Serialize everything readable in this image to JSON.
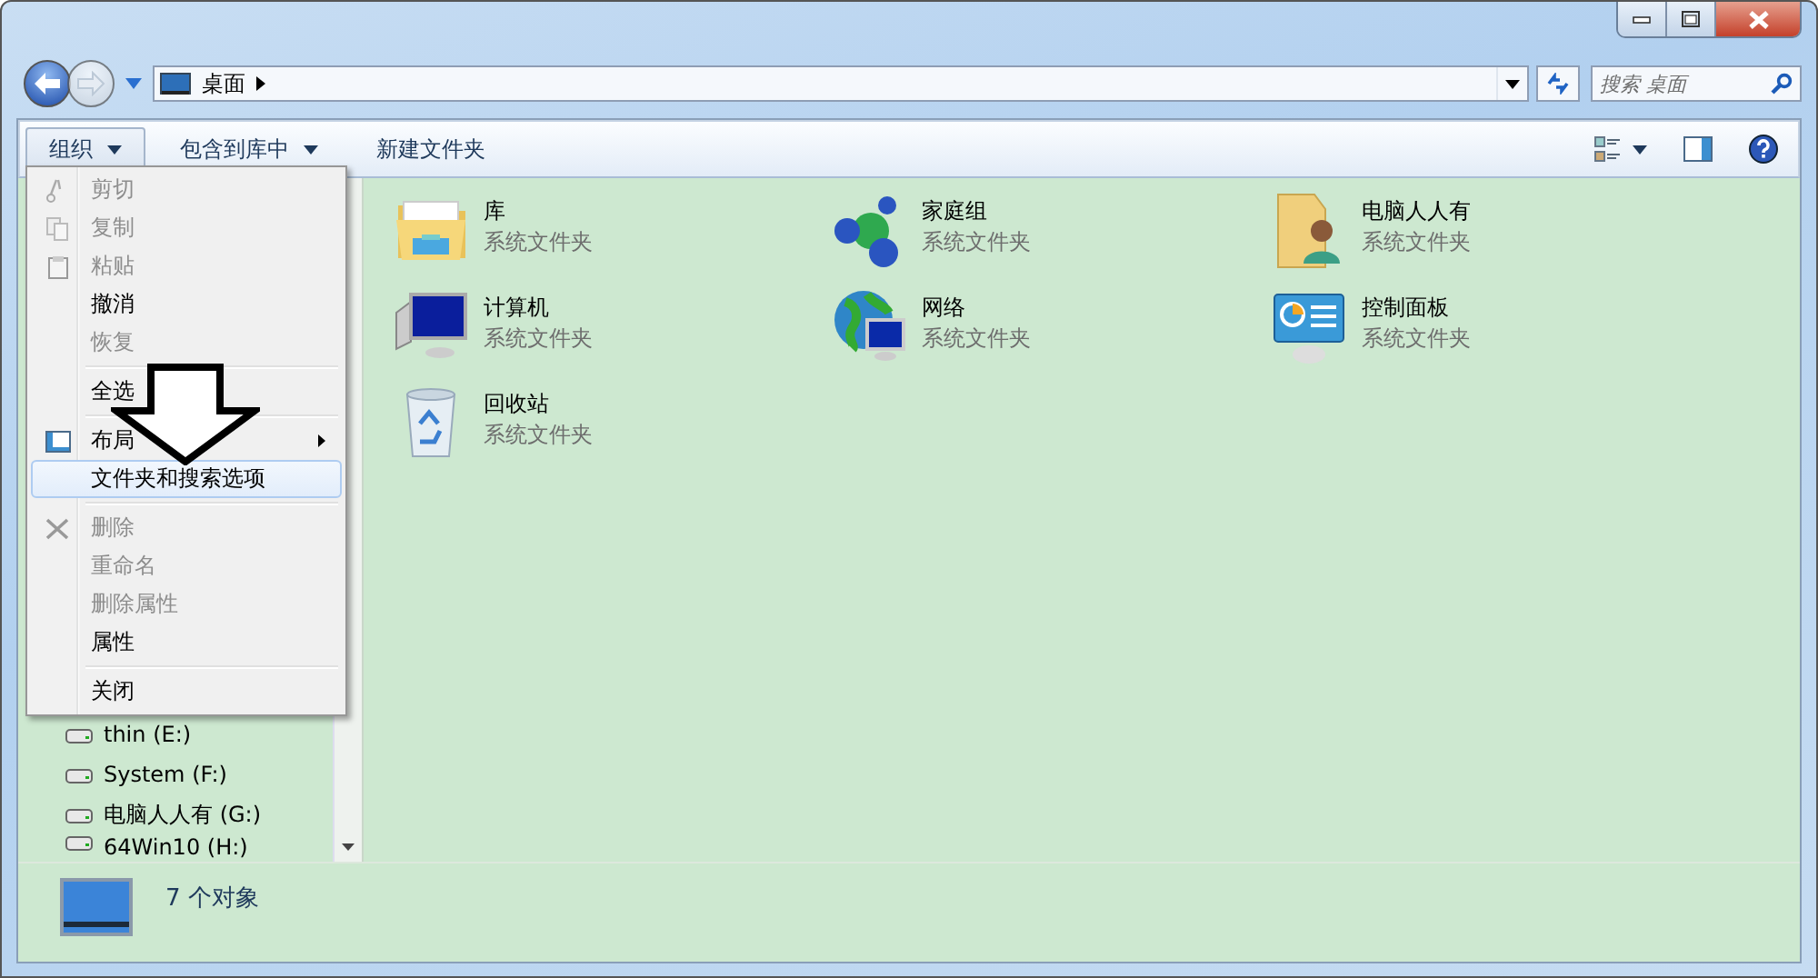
{
  "address_bar": {
    "location": "桌面",
    "forward_disabled": true
  },
  "search": {
    "placeholder": "搜索 桌面"
  },
  "toolbar": {
    "buttons": [
      {
        "label": "组织",
        "dropdown": true,
        "pressed": true
      },
      {
        "label": "包含到库中",
        "dropdown": true,
        "pressed": false
      },
      {
        "label": "新建文件夹",
        "dropdown": false,
        "pressed": false
      }
    ]
  },
  "menu": {
    "items": [
      {
        "kind": "item",
        "label": "剪切",
        "disabled": true,
        "selected": false,
        "submenu": false
      },
      {
        "kind": "item",
        "label": "复制",
        "disabled": true,
        "selected": false,
        "submenu": false
      },
      {
        "kind": "item",
        "label": "粘贴",
        "disabled": true,
        "selected": false,
        "submenu": false
      },
      {
        "kind": "item",
        "label": "撤消",
        "disabled": false,
        "selected": false,
        "submenu": false
      },
      {
        "kind": "item",
        "label": "恢复",
        "disabled": true,
        "selected": false,
        "submenu": false
      },
      {
        "kind": "separator"
      },
      {
        "kind": "item",
        "label": "全选",
        "disabled": false,
        "selected": false,
        "submenu": false
      },
      {
        "kind": "separator"
      },
      {
        "kind": "item",
        "label": "布局",
        "disabled": false,
        "selected": false,
        "submenu": true
      },
      {
        "kind": "item",
        "label": "文件夹和搜索选项",
        "disabled": false,
        "selected": true,
        "submenu": false
      },
      {
        "kind": "separator"
      },
      {
        "kind": "item",
        "label": "删除",
        "disabled": true,
        "selected": false,
        "submenu": false
      },
      {
        "kind": "item",
        "label": "重命名",
        "disabled": true,
        "selected": false,
        "submenu": false
      },
      {
        "kind": "item",
        "label": "删除属性",
        "disabled": true,
        "selected": false,
        "submenu": false
      },
      {
        "kind": "item",
        "label": "属性",
        "disabled": false,
        "selected": false,
        "submenu": false
      },
      {
        "kind": "separator"
      },
      {
        "kind": "item",
        "label": "关闭",
        "disabled": false,
        "selected": false,
        "submenu": false
      }
    ]
  },
  "nav_pane": {
    "items": [
      {
        "label": "thin (E:)"
      },
      {
        "label": "System (F:)"
      },
      {
        "label": "电脑人人有 (G:)"
      },
      {
        "label": "64Win10 (H:)"
      }
    ]
  },
  "content": {
    "items": [
      {
        "name": "库",
        "type": "系统文件夹"
      },
      {
        "name": "家庭组",
        "type": "系统文件夹"
      },
      {
        "name": "电脑人人有",
        "type": "系统文件夹"
      },
      {
        "name": "计算机",
        "type": "系统文件夹"
      },
      {
        "name": "网络",
        "type": "系统文件夹"
      },
      {
        "name": "控制面板",
        "type": "系统文件夹"
      },
      {
        "name": "回收站",
        "type": "系统文件夹"
      }
    ]
  },
  "details_pane": {
    "count": "7 个对象"
  }
}
